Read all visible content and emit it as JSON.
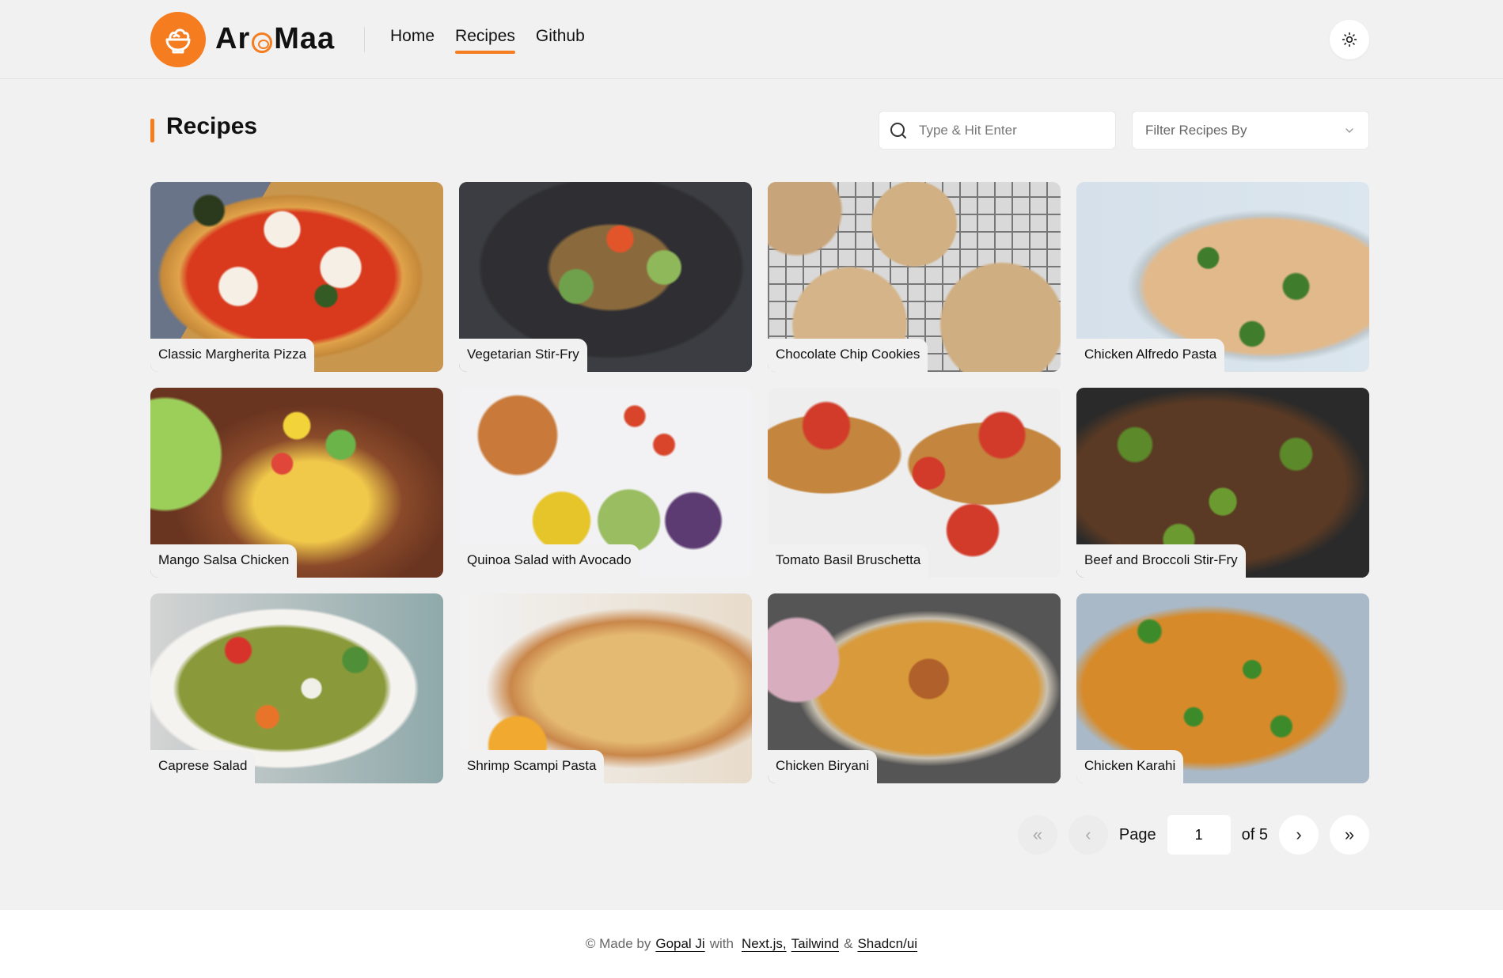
{
  "brand": {
    "name_prefix": "Ar",
    "name_suffix": "Maa",
    "accent_color": "#f57c1f",
    "logo_icon": "salad-bowl-icon"
  },
  "nav": {
    "items": [
      {
        "label": "Home",
        "active": false
      },
      {
        "label": "Recipes",
        "active": true
      },
      {
        "label": "Github",
        "active": false
      }
    ],
    "theme_toggle_icon": "sun-icon"
  },
  "page": {
    "title": "Recipes"
  },
  "search": {
    "placeholder": "Type & Hit Enter",
    "value": ""
  },
  "filter": {
    "placeholder": "Filter Recipes By"
  },
  "recipes": [
    {
      "name": "Classic Margherita Pizza"
    },
    {
      "name": "Vegetarian Stir-Fry"
    },
    {
      "name": "Chocolate Chip Cookies"
    },
    {
      "name": "Chicken Alfredo Pasta"
    },
    {
      "name": "Mango Salsa Chicken"
    },
    {
      "name": "Quinoa Salad with Avocado"
    },
    {
      "name": "Tomato Basil Bruschetta"
    },
    {
      "name": "Beef and Broccoli Stir-Fry"
    },
    {
      "name": "Caprese Salad"
    },
    {
      "name": "Shrimp Scampi Pasta"
    },
    {
      "name": "Chicken Biryani"
    },
    {
      "name": "Chicken Karahi"
    }
  ],
  "pagination": {
    "first_label": "«",
    "prev_label": "‹",
    "page_label": "Page",
    "current_page": "1",
    "of_label": "of 5",
    "next_label": "›",
    "last_label": "»"
  },
  "footer": {
    "prefix": "© Made by",
    "author": "Gopal Ji",
    "with": "with",
    "tech1": "Next.js,",
    "tech2": "Tailwind",
    "amp": "&",
    "tech3": "Shadcn/ui"
  }
}
